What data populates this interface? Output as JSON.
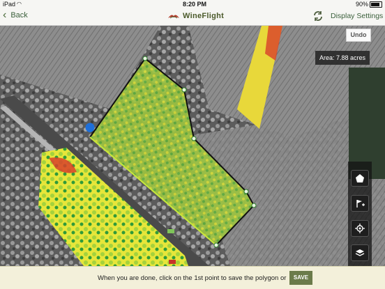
{
  "status_bar": {
    "carrier": "iPad",
    "time": "8:20 PM",
    "battery": "90%"
  },
  "nav": {
    "back_label": "Back",
    "app_name": "WineFlight",
    "display_settings_label": "Display Settings"
  },
  "map": {
    "undo_label": "Undo",
    "area_label": "Area: 7.88 acres"
  },
  "tools": [
    "polygon-icon",
    "flag-add-icon",
    "locate-icon",
    "layers-icon"
  ],
  "bottom": {
    "instruction": "When you are done, click on the 1st point to save the polygon or",
    "save_label": "SAVE"
  },
  "colors": {
    "accent": "#4a6b3a",
    "save_button": "#6b7b4a",
    "polygon_fill": "#9ab83a"
  }
}
